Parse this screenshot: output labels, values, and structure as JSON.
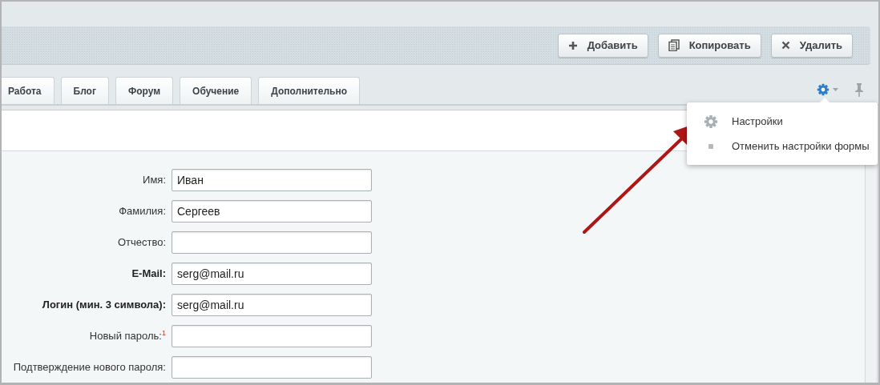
{
  "toolbar": {
    "buttons": [
      {
        "label": "Добавить",
        "kind": "add"
      },
      {
        "label": "Копировать",
        "kind": "copy"
      },
      {
        "label": "Удалить",
        "kind": "delete"
      }
    ]
  },
  "tabs": [
    {
      "label": "Работа"
    },
    {
      "label": "Блог"
    },
    {
      "label": "Форум"
    },
    {
      "label": "Обучение"
    },
    {
      "label": "Дополнительно"
    }
  ],
  "settings_menu": {
    "items": [
      {
        "label": "Настройки",
        "kind": "gear"
      },
      {
        "label": "Отменить настройки формы",
        "kind": "dot"
      }
    ]
  },
  "form": {
    "fields": [
      {
        "label": "Имя:",
        "value": "Иван",
        "bold": false
      },
      {
        "label": "Фамилия:",
        "value": "Сергеев",
        "bold": false
      },
      {
        "label": "Отчество:",
        "bold": false
      },
      {
        "label": "E-Mail:",
        "value": "serg@mail.ru",
        "bold": true
      },
      {
        "label": "Логин (мин. 3 символа):",
        "value": "serg@mail.ru",
        "bold": true
      },
      {
        "label": "Новый пароль:$^{1}$",
        "bold": false
      },
      {
        "label": "Подтверждение нового пароля:",
        "bold": false
      }
    ]
  }
}
